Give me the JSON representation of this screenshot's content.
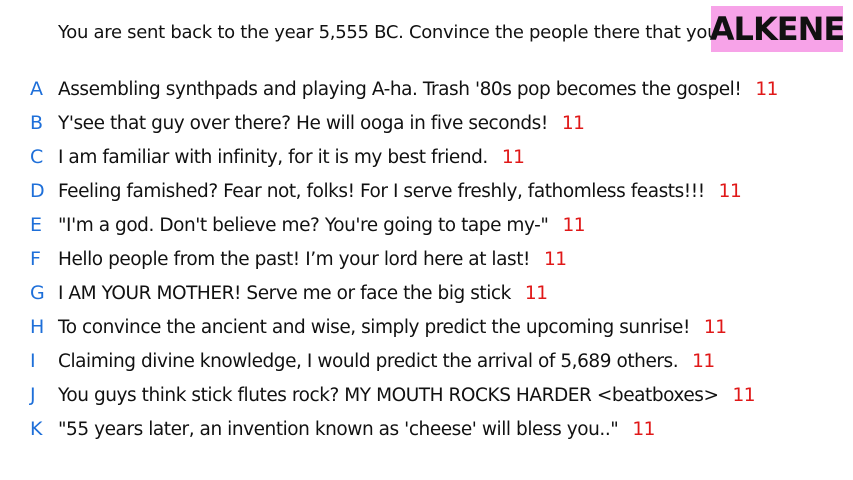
{
  "prompt": "You are sent back to the year 5,555 BC. Convince the people there that you're a god.",
  "player_name": "ALKENE",
  "colors": {
    "badge_bg": "#f7a3e8",
    "letter": "#1e6fd9",
    "score": "#e01818",
    "text": "#111111"
  },
  "answers": [
    {
      "letter": "A",
      "text": "Assembling synthpads and playing A-ha. Trash '80s pop becomes the gospel!",
      "score": "11"
    },
    {
      "letter": "B",
      "text": "Y'see that guy over there? He will ooga in five seconds!",
      "score": "11"
    },
    {
      "letter": "C",
      "text": "I am familiar with infinity, for it is my best friend.",
      "score": "11"
    },
    {
      "letter": "D",
      "text": "Feeling famished? Fear not, folks! For I serve freshly, fathomless feasts!!!",
      "score": "11"
    },
    {
      "letter": "E",
      "text": "\"I'm a god. Don't believe me? You're going to tape my-\"",
      "score": "11"
    },
    {
      "letter": "F",
      "text": "Hello people from the past! I’m your lord here at last!",
      "score": "11"
    },
    {
      "letter": "G",
      "text": "I AM YOUR MOTHER! Serve me or face the big stick",
      "score": "11"
    },
    {
      "letter": "H",
      "text": "To convince the ancient and wise, simply predict the upcoming sunrise!",
      "score": "11"
    },
    {
      "letter": "I",
      "text": "Claiming divine knowledge, I would predict the arrival of 5,689 others.",
      "score": "11"
    },
    {
      "letter": "J",
      "text": "You guys think stick flutes rock? MY MOUTH ROCKS HARDER <beatboxes>",
      "score": "11"
    },
    {
      "letter": "K",
      "text": "\"55 years later, an invention known as 'cheese' will bless you..\"",
      "score": "11"
    }
  ]
}
